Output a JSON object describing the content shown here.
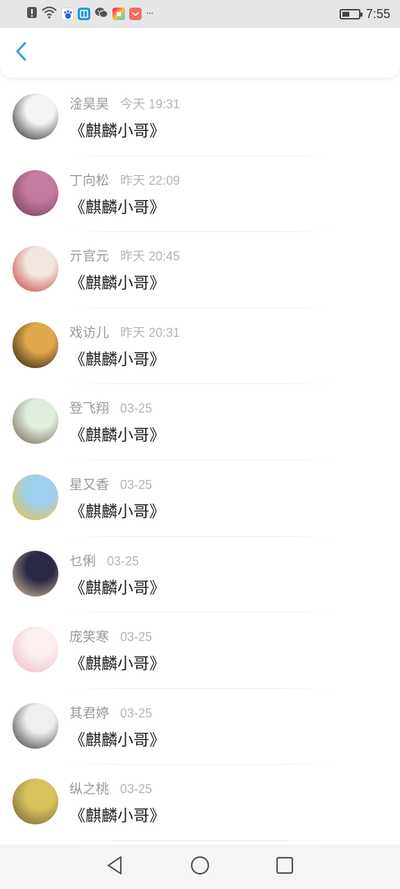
{
  "status_bar": {
    "time": "7:55",
    "more": "···",
    "battery_level": 0.45,
    "icons": [
      "alert-icon",
      "wifi-icon",
      "baidu-app-icon",
      "book-app-icon",
      "wechat-icon",
      "app-icon",
      "mail-app-icon"
    ]
  },
  "header": {
    "back_icon": "chevron-left-icon",
    "accent_color": "#2f9fd8"
  },
  "list": {
    "items": [
      {
        "name": "淦昊昊",
        "time": "今天 19:31",
        "message": "《麒麟小哥》",
        "avatar_colors": [
          "#f4f4f4",
          "#1a1a1a"
        ]
      },
      {
        "name": "丁向松",
        "time": "昨天 22:09",
        "message": "《麒麟小哥》",
        "avatar_colors": [
          "#c77aa0",
          "#6d3b55"
        ]
      },
      {
        "name": "亓官元",
        "time": "昨天 20:45",
        "message": "《麒麟小哥》",
        "avatar_colors": [
          "#f1e6e0",
          "#c8322e"
        ]
      },
      {
        "name": "戏访儿",
        "time": "昨天 20:31",
        "message": "《麒麟小哥》",
        "avatar_colors": [
          "#e0a84a",
          "#1b1410"
        ]
      },
      {
        "name": "登飞翔",
        "time": "03-25",
        "message": "《麒麟小哥》",
        "avatar_colors": [
          "#dfeedd",
          "#6e5a4c"
        ]
      },
      {
        "name": "星又香",
        "time": "03-25",
        "message": "《麒麟小哥》",
        "avatar_colors": [
          "#9fd0ef",
          "#f0c030"
        ]
      },
      {
        "name": "乜俐",
        "time": "03-25",
        "message": "《麒麟小哥》",
        "avatar_colors": [
          "#2b2a45",
          "#e2c6a0"
        ]
      },
      {
        "name": "庞笑寒",
        "time": "03-25",
        "message": "《麒麟小哥》",
        "avatar_colors": [
          "#fbeff0",
          "#f0b6bd"
        ]
      },
      {
        "name": "其君婷",
        "time": "03-25",
        "message": "《麒麟小哥》",
        "avatar_colors": [
          "#efefef",
          "#2a2a2a"
        ]
      },
      {
        "name": "纵之桃",
        "time": "03-25",
        "message": "《麒麟小哥》",
        "avatar_colors": [
          "#d8c35a",
          "#6a5a40"
        ]
      }
    ]
  },
  "nav_bar": {
    "back": "nav-back-triangle-icon",
    "home": "nav-home-circle-icon",
    "recents": "nav-recents-square-icon"
  }
}
